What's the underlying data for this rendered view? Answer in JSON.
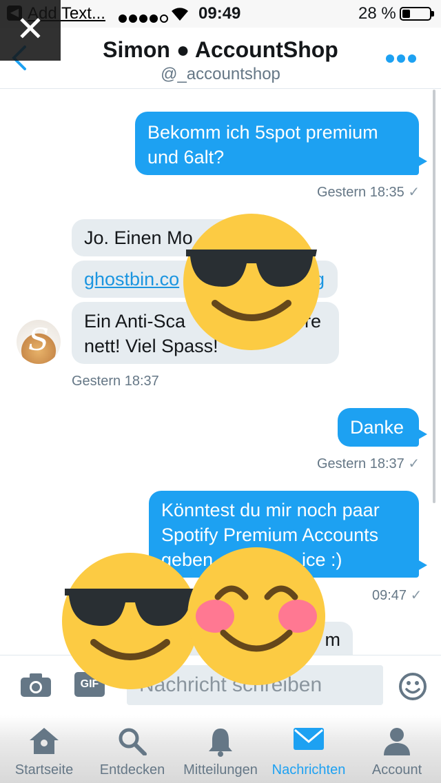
{
  "status_bar": {
    "app_back_label": "Add Text...",
    "time": "09:49",
    "battery_pct": "28 %",
    "battery_level": 0.28
  },
  "header": {
    "title": "Simon ● AccountShop",
    "handle": "@_accountshop"
  },
  "messages": [
    {
      "dir": "out",
      "text_lines": [
        "Bekomm ich 5spot premium",
        "und 6alt?"
      ],
      "time": "Gestern 18:35"
    },
    {
      "dir": "in",
      "text": "Jo. Einen Mo"
    },
    {
      "dir": "in",
      "link": "ghostbin.co",
      "link_tail": "g"
    },
    {
      "dir": "in",
      "text_lines": [
        "Ein Anti-Sca",
        "re",
        "nett! Viel Spass!"
      ],
      "time": "Gestern 18:37"
    },
    {
      "dir": "out",
      "text": "Danke",
      "time": "Gestern 18:37"
    },
    {
      "dir": "out",
      "text_lines": [
        "Könntest du mir noch paar",
        "Spotify Premium Accounts",
        "geben",
        "ice :)"
      ],
      "time": "09:47"
    },
    {
      "dir": "in",
      "text": "m"
    }
  ],
  "composer": {
    "gif_label": "GIF",
    "placeholder": "Nachricht schreiben"
  },
  "tabs": [
    {
      "label": "Startseite",
      "icon": "home-icon",
      "active": false
    },
    {
      "label": "Entdecken",
      "icon": "search-icon",
      "active": false
    },
    {
      "label": "Mitteilungen",
      "icon": "bell-icon",
      "active": false
    },
    {
      "label": "Nachrichten",
      "icon": "envelope-icon",
      "active": true
    },
    {
      "label": "Account",
      "icon": "person-icon",
      "active": false
    }
  ],
  "colors": {
    "accent": "#1da1f2",
    "incoming_bubble": "#e6ecf0",
    "emoji_yellow": "#fccb43"
  }
}
